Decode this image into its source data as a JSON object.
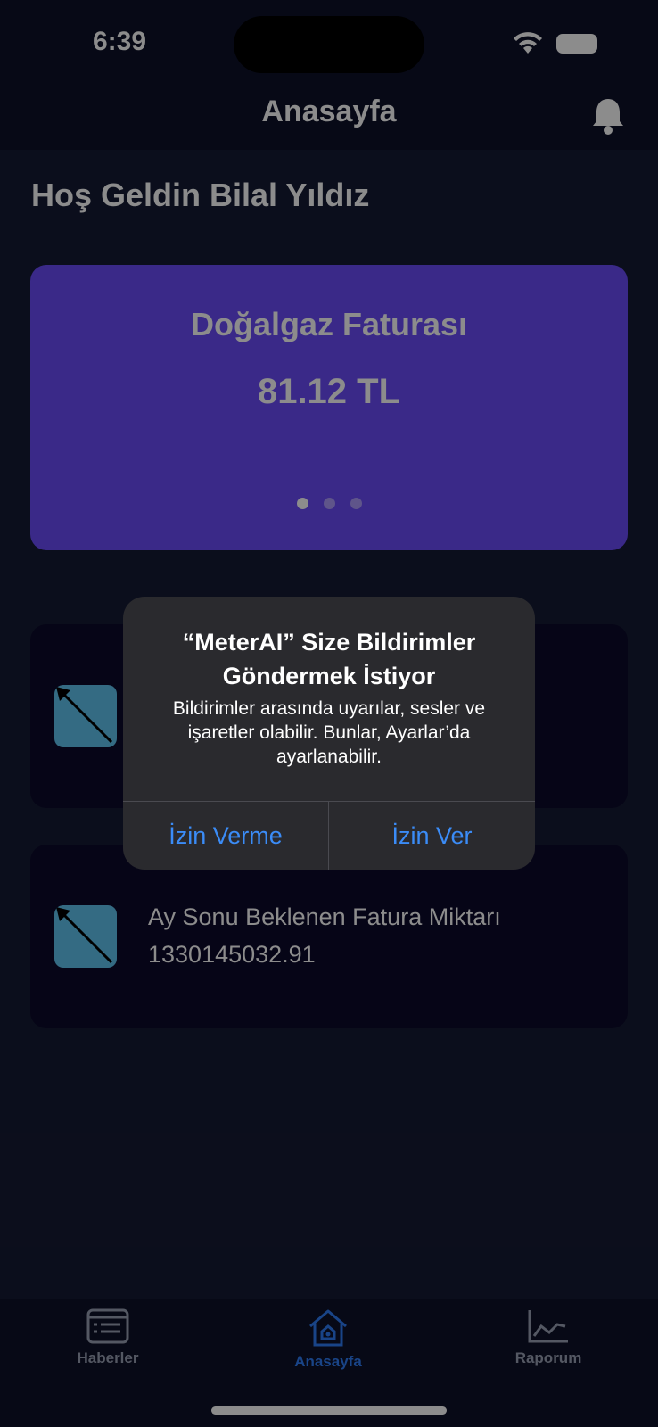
{
  "status_bar": {
    "time": "6:39"
  },
  "header": {
    "title": "Anasayfa"
  },
  "welcome": "Hoş Geldin Bilal Yıldız",
  "bill_card": {
    "title": "Doğalgaz Faturası",
    "amount": "81.12 TL",
    "pages": 3,
    "active_page": 1
  },
  "info_cards": [
    {
      "label": "",
      "value": ""
    },
    {
      "label": "Ay Sonu Beklenen Fatura Miktarı",
      "value": "1330145032.91"
    }
  ],
  "alert": {
    "title": "“MeterAI” Size Bildirimler Göndermek İstiyor",
    "message": "Bildirimler arasında uyarılar, sesler ve işaretler olabilir. Bunlar, Ayarlar’da ayarlanabilir.",
    "deny_label": "İzin Verme",
    "allow_label": "İzin Ver"
  },
  "tabs": [
    {
      "label": "Haberler",
      "icon": "news-icon"
    },
    {
      "label": "Anasayfa",
      "icon": "home-icon",
      "active": true
    },
    {
      "label": "Raporum",
      "icon": "chart-icon"
    }
  ],
  "colors": {
    "accent": "#2f7df6",
    "card_purple": "#6a4cf8",
    "alert_button": "#3b8cf7"
  }
}
